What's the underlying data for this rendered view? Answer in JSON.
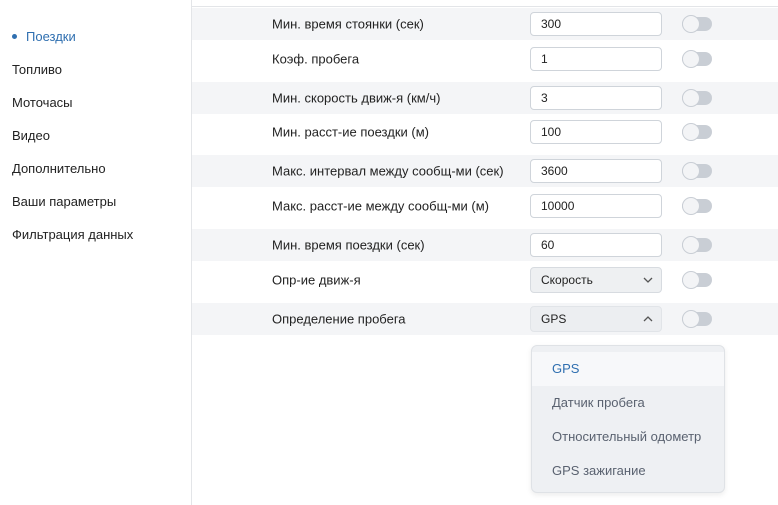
{
  "sidebar": {
    "items": [
      {
        "label": "Поездки",
        "active": true
      },
      {
        "label": "Топливо"
      },
      {
        "label": "Моточасы"
      },
      {
        "label": "Видео"
      },
      {
        "label": "Дополнительно"
      },
      {
        "label": "Ваши параметры"
      },
      {
        "label": "Фильтрация данных"
      }
    ]
  },
  "settings": {
    "rows": [
      {
        "label": "Мин. время стоянки (сек)",
        "value": "300"
      },
      {
        "label": "Коэф. пробега",
        "value": "1"
      },
      {
        "label": "Мин. скорость движ-я (км/ч)",
        "value": "3"
      },
      {
        "label": "Мин. расст-ие поездки (м)",
        "value": "100"
      },
      {
        "label": "Макс. интервал между сообщ-ми (сек)",
        "value": "3600"
      },
      {
        "label": "Макс. расст-ие между сообщ-ми (м)",
        "value": "10000"
      },
      {
        "label": "Мин. время поездки (сек)",
        "value": "60"
      },
      {
        "label": "Опр-ие движ-я",
        "value": "Скорость"
      },
      {
        "label": "Определение пробега",
        "value": "GPS"
      }
    ]
  },
  "dropdown": {
    "options": [
      "GPS",
      "Датчик пробега",
      "Относительный одометр",
      "GPS зажигание"
    ],
    "selected": "GPS"
  },
  "colors": {
    "accent": "#2f6fb0",
    "row_shade": "#f4f5f7",
    "toggle_off": "#c9ced5"
  }
}
